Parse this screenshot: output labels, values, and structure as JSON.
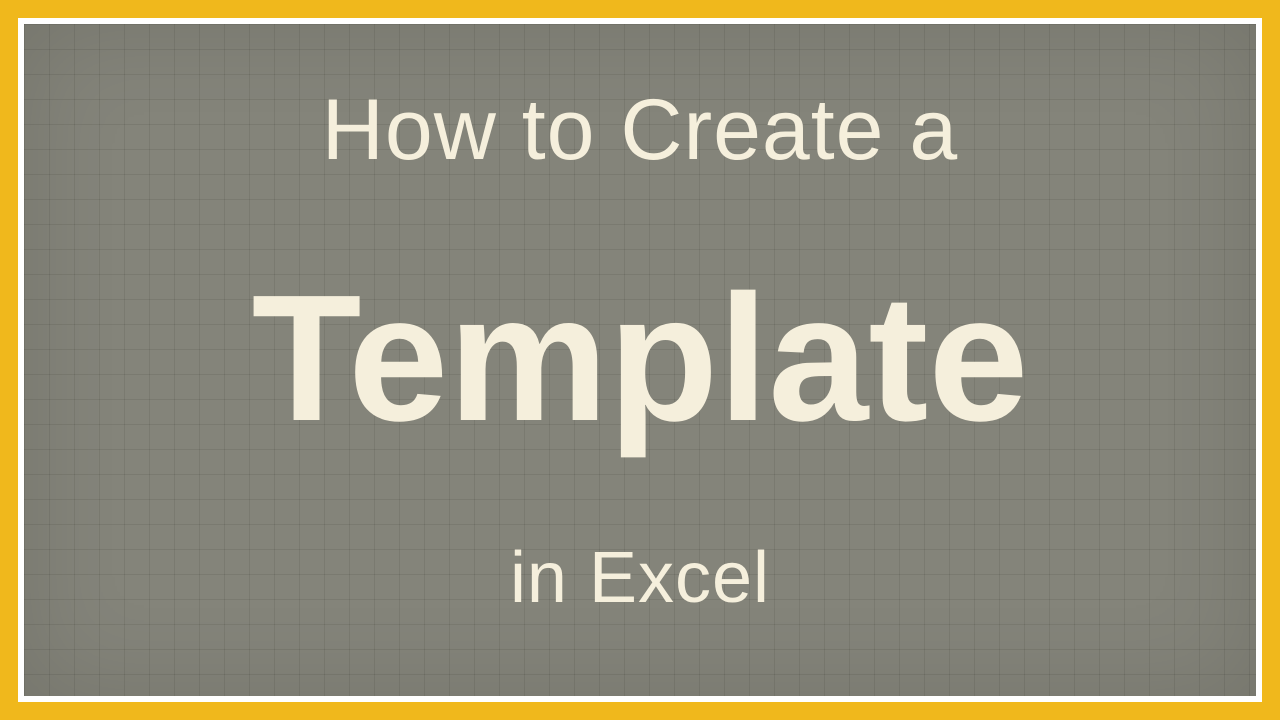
{
  "title": {
    "line1": "How to Create a",
    "line2": "Template",
    "line3": "in Excel"
  },
  "colors": {
    "border": "#f0b81c",
    "inner_border": "#ffffff",
    "background": "#84847a",
    "text": "#f5efdc"
  }
}
